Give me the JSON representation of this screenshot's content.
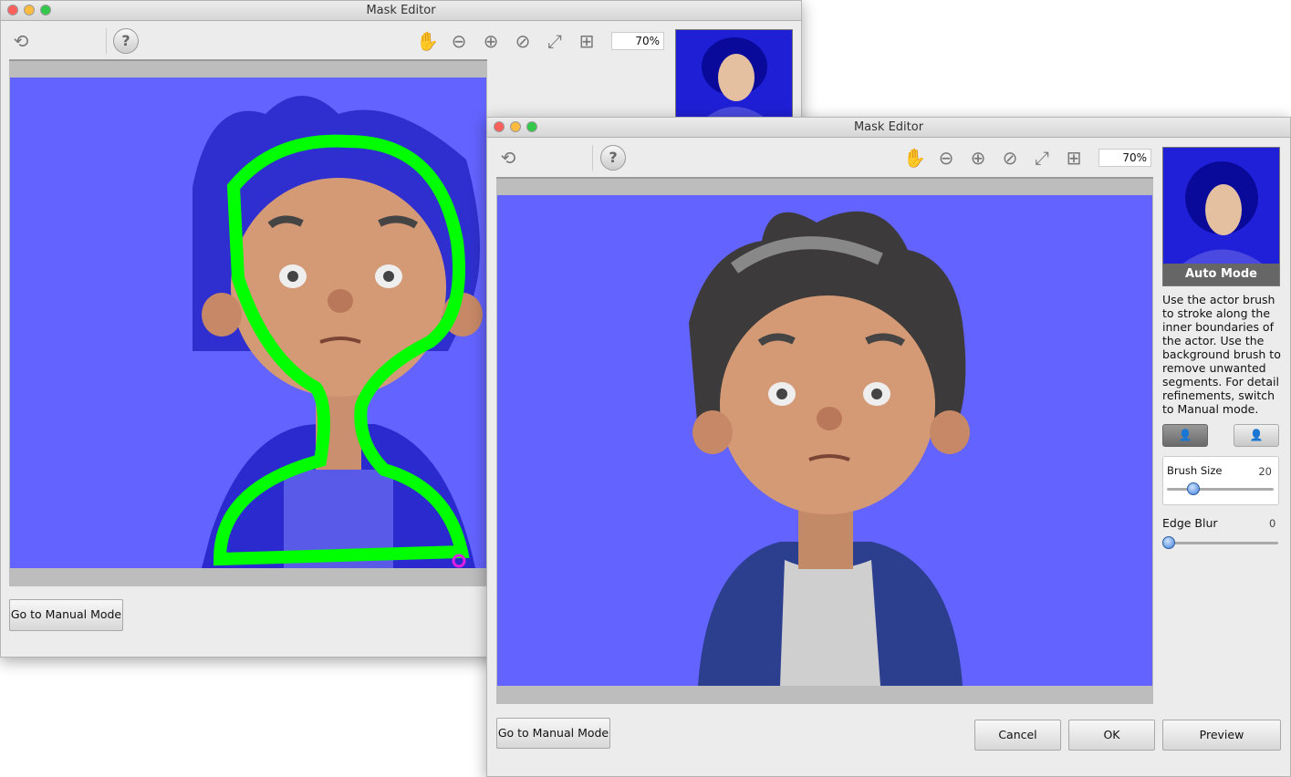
{
  "back_window": {
    "title": "Mask Editor",
    "zoom_level": "70%",
    "manual_mode_button": "Go to Manual Mode"
  },
  "front_window": {
    "title": "Mask Editor",
    "zoom_level": "70%",
    "thumbnail_label": "Auto Mode",
    "instructions": "Use the actor brush to stroke along the inner boundaries of the actor. Use the background brush to remove unwanted segments. For detail refinements, switch to Manual mode.",
    "brush_size_label": "Brush Size",
    "brush_size_value": "20",
    "brush_size_fraction": 0.2,
    "edge_blur_label": "Edge Blur",
    "edge_blur_value": "0",
    "edge_blur_fraction": 0,
    "manual_mode_button": "Go to Manual Mode",
    "cancel_button": "Cancel",
    "ok_button": "OK",
    "preview_button": "Preview"
  },
  "colors": {
    "background_mask": "#6363ff",
    "actor_stroke": "#00ff00"
  },
  "icons": [
    "reset-icon",
    "help-icon",
    "hand-icon",
    "zoom-out-icon",
    "zoom-in-icon",
    "zoom-reset-icon",
    "fit-icon",
    "zoom-selection-icon",
    "actor-brush-icon",
    "background-brush-icon"
  ]
}
